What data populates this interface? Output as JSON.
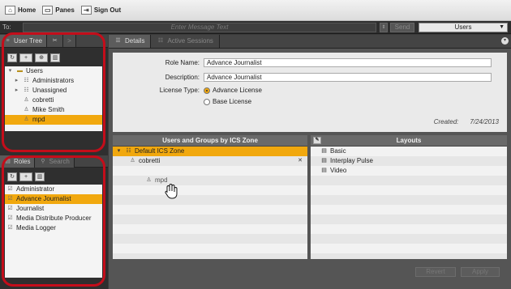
{
  "toolbar": {
    "home": "Home",
    "panes": "Panes",
    "signout": "Sign Out"
  },
  "message_bar": {
    "to_label": "To:",
    "placeholder": "Enter Message Text",
    "send": "Send",
    "recipient": "Users"
  },
  "left": {
    "top_tabs": [
      "User Tree"
    ],
    "tree": {
      "root": "Users",
      "items": [
        {
          "label": "Administrators",
          "icon": "group-icon"
        },
        {
          "label": "Unassigned",
          "icon": "group-icon"
        },
        {
          "label": "cobretti",
          "icon": "user-icon"
        },
        {
          "label": "Mike Smith",
          "icon": "user-icon"
        },
        {
          "label": "mpd",
          "icon": "user-icon",
          "selected": true
        }
      ]
    },
    "bottom_tabs": [
      "Roles",
      "Search"
    ],
    "roles": [
      {
        "label": "Administrator"
      },
      {
        "label": "Advance Journalist",
        "selected": true
      },
      {
        "label": "Journalist"
      },
      {
        "label": "Media Distribute Producer"
      },
      {
        "label": "Media Logger"
      }
    ]
  },
  "main": {
    "tabs": [
      "Details",
      "Active Sessions"
    ],
    "details": {
      "role_name_label": "Role Name:",
      "role_name": "Advance Journalist",
      "description_label": "Description:",
      "description": "Advance Journalist",
      "license_label": "License Type:",
      "license_options": [
        "Advance License",
        "Base License"
      ],
      "license_selected": "Advance License",
      "created_label": "Created:",
      "created_date": "7/24/2013"
    },
    "users_groups": {
      "header": "Users and Groups by ICS Zone",
      "zone": "Default ICS Zone",
      "members": [
        "cobretti"
      ],
      "dragging": "mpd",
      "remove_glyph": "✕"
    },
    "layouts": {
      "header": "Layouts",
      "items": [
        "Basic",
        "Interplay Pulse",
        "Video"
      ]
    },
    "buttons": {
      "revert": "Revert",
      "apply": "Apply"
    }
  },
  "colors": {
    "accent": "#f1a80e",
    "annotation_ring": "#c40d1a"
  }
}
